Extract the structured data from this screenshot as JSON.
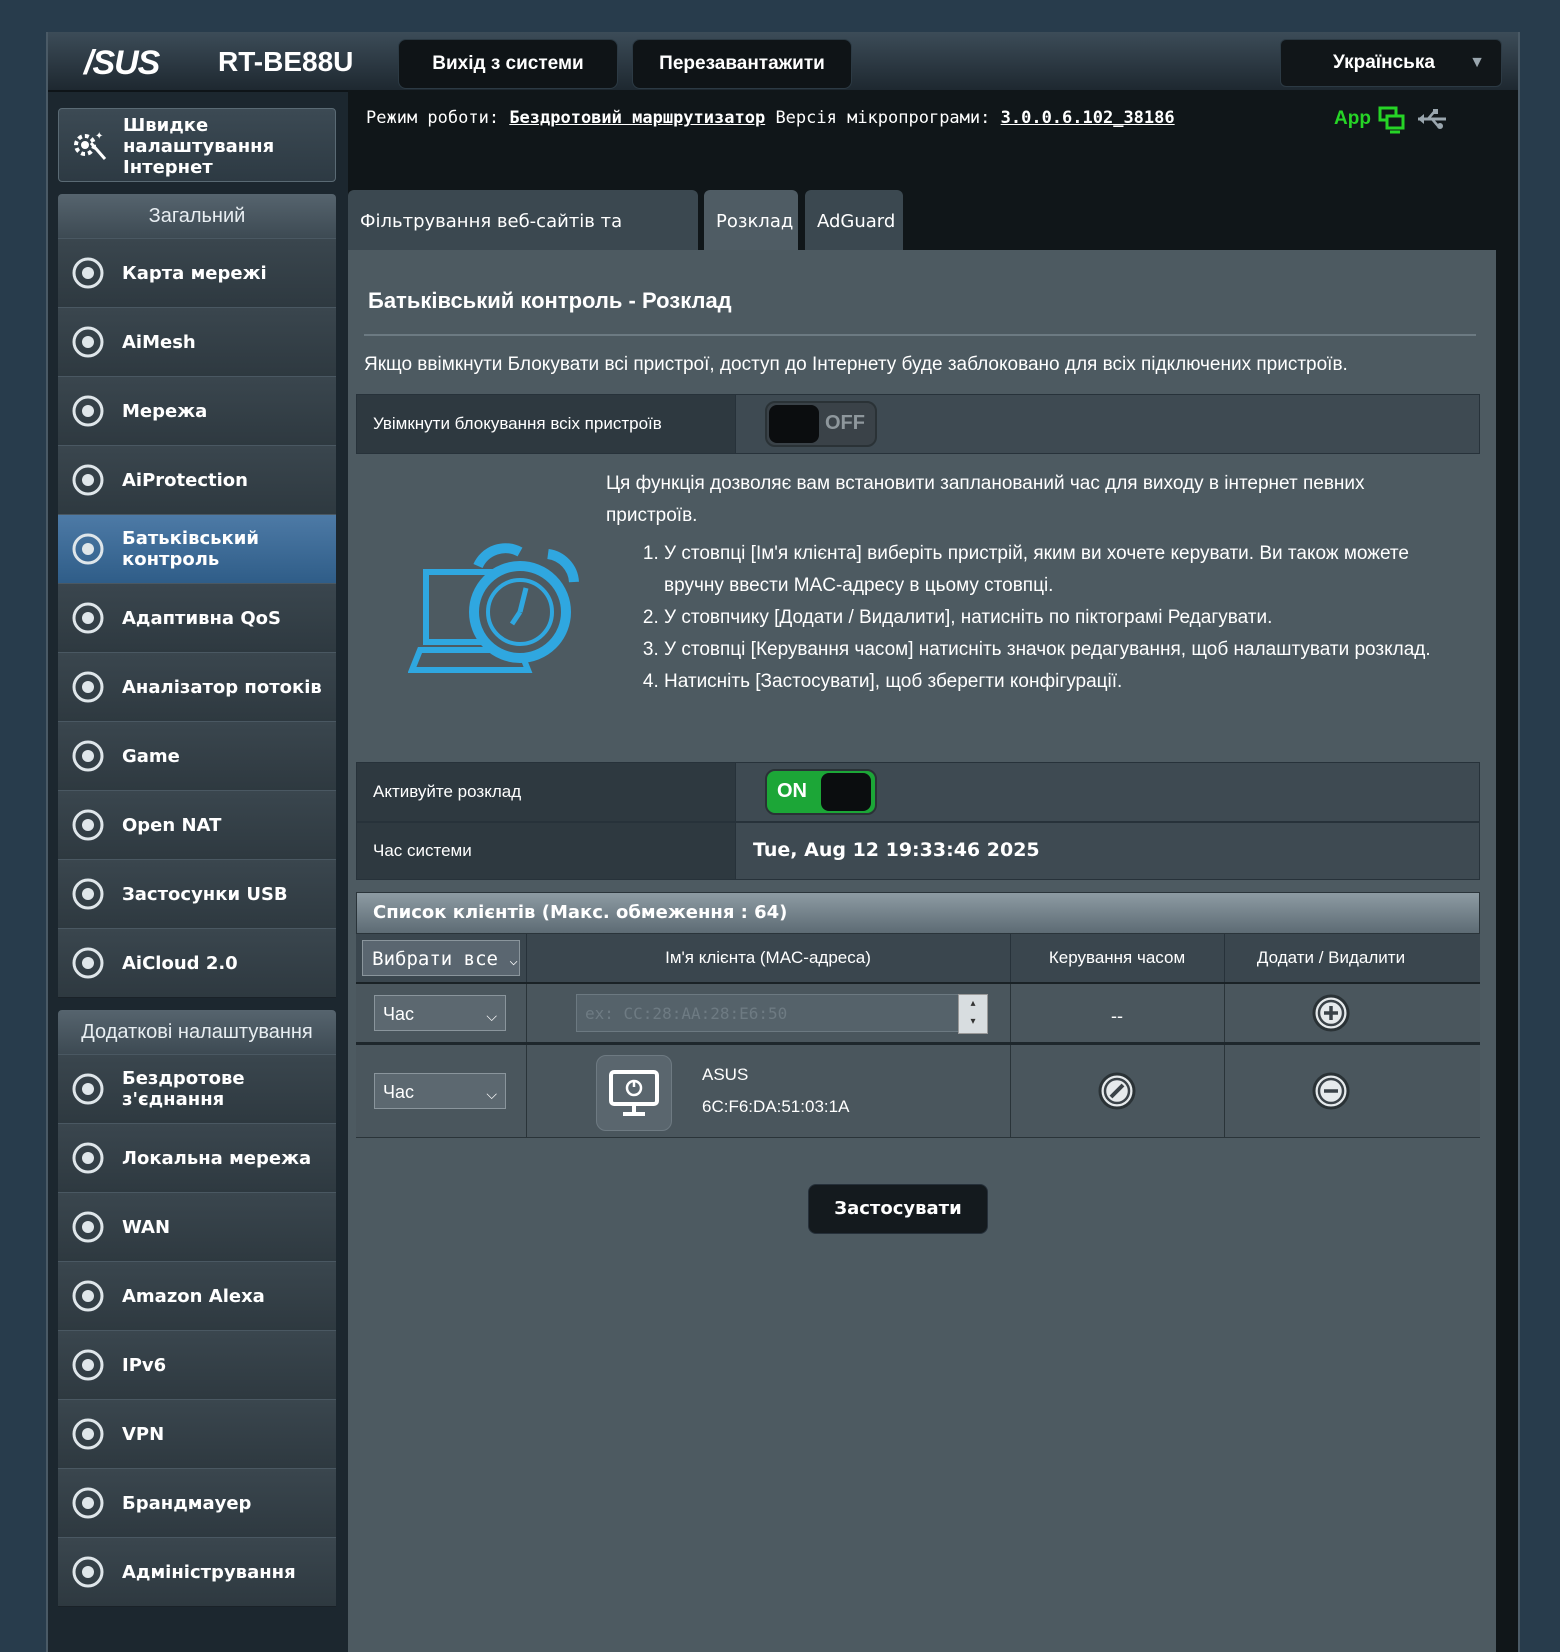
{
  "header": {
    "brand": "/SUS",
    "model": "RT-BE88U",
    "logout_label": "Вихід з системи",
    "reboot_label": "Перезавантажити",
    "language": "Українська"
  },
  "status": {
    "mode_label": "Режим роботи:",
    "mode_value": "Бездротовий маршрутизатор",
    "fw_label": "Версія мікропрограми:",
    "fw_value": "3.0.0.6.102_38186",
    "app_label": "App"
  },
  "sidebar": {
    "qis_label": "Швидке налаштування Інтернет",
    "general_header": "Загальний",
    "general_items": [
      {
        "label": "Карта мережі",
        "icon": "network-map-icon"
      },
      {
        "label": "AiMesh",
        "icon": "aimesh-icon"
      },
      {
        "label": "Мережа",
        "icon": "network-icon"
      },
      {
        "label": "AiProtection",
        "icon": "aiprotection-icon"
      },
      {
        "label": "Батьківський контроль",
        "icon": "parental-control-icon"
      },
      {
        "label": "Адаптивна QoS",
        "icon": "qos-icon"
      },
      {
        "label": "Аналізатор потоків",
        "icon": "traffic-analyzer-icon"
      },
      {
        "label": "Game",
        "icon": "game-icon"
      },
      {
        "label": "Open NAT",
        "icon": "open-nat-icon"
      },
      {
        "label": "Застосунки USB",
        "icon": "usb-apps-icon"
      },
      {
        "label": "AiCloud 2.0",
        "icon": "aicloud-icon"
      }
    ],
    "advanced_header": "Додаткові налаштування",
    "advanced_items": [
      {
        "label": "Бездротове з'єднання",
        "icon": "wireless-icon"
      },
      {
        "label": "Локальна мережа",
        "icon": "lan-icon"
      },
      {
        "label": "WAN",
        "icon": "wan-icon"
      },
      {
        "label": "Amazon Alexa",
        "icon": "alexa-icon"
      },
      {
        "label": "IPv6",
        "icon": "ipv6-icon"
      },
      {
        "label": "VPN",
        "icon": "vpn-icon"
      },
      {
        "label": "Брандмауер",
        "icon": "firewall-icon"
      },
      {
        "label": "Адміністрування",
        "icon": "admin-icon"
      }
    ]
  },
  "tabs": [
    {
      "label": "Фільтрування веб-сайтів та програм"
    },
    {
      "label": "Розклад"
    },
    {
      "label": "AdGuard"
    }
  ],
  "page": {
    "title": "Батьківський контроль - Розклад",
    "block_note": "Якщо ввімкнути Блокувати всі пристрої, доступ до Інтернету буде заблоковано для всіх підключених пристроїв.",
    "block_all_label": "Увімкнути блокування всіх пристроїв",
    "block_all_state": "OFF",
    "intro": "Ця функція дозволяє вам встановити запланований час для виходу в інтернет певних пристроїв.",
    "steps": [
      "У стовпці [Ім'я клієнта] виберіть пристрій, яким ви хочете керувати. Ви також можете вручну ввести MAC-адресу в цьому стовпці.",
      "У стовпчику [Додати / Видалити], натисніть по піктограмі Редагувати.",
      "У стовпці [Керування часом] натисніть значок редагування, щоб налаштувати розклад.",
      "Натисніть [Застосувати], щоб зберегти конфігурації."
    ],
    "schedule_label": "Активуйте розклад",
    "schedule_state": "ON",
    "systime_label": "Час системи",
    "systime_value": "Tue, Aug 12 19:33:46 2025",
    "list_title": "Список клієнтів (Макс. обмеження : 64)",
    "select_all": "Вибрати все",
    "col_client": "Ім'я клієнта (MAC-адреса)",
    "col_time": "Керування часом",
    "col_addremove": "Додати / Видалити",
    "new_row": {
      "mode": "Час",
      "mac_placeholder": "ex: CC:28:AA:28:E6:50",
      "time_value": "--"
    },
    "clients": [
      {
        "mode": "Час",
        "name": "ASUS",
        "mac": "6C:F6:DA:51:03:1A"
      }
    ],
    "apply_label": "Застосувати"
  },
  "colors": {
    "accent": "#2f5d88",
    "on_green": "#1ca637",
    "app_green": "#26d426"
  }
}
